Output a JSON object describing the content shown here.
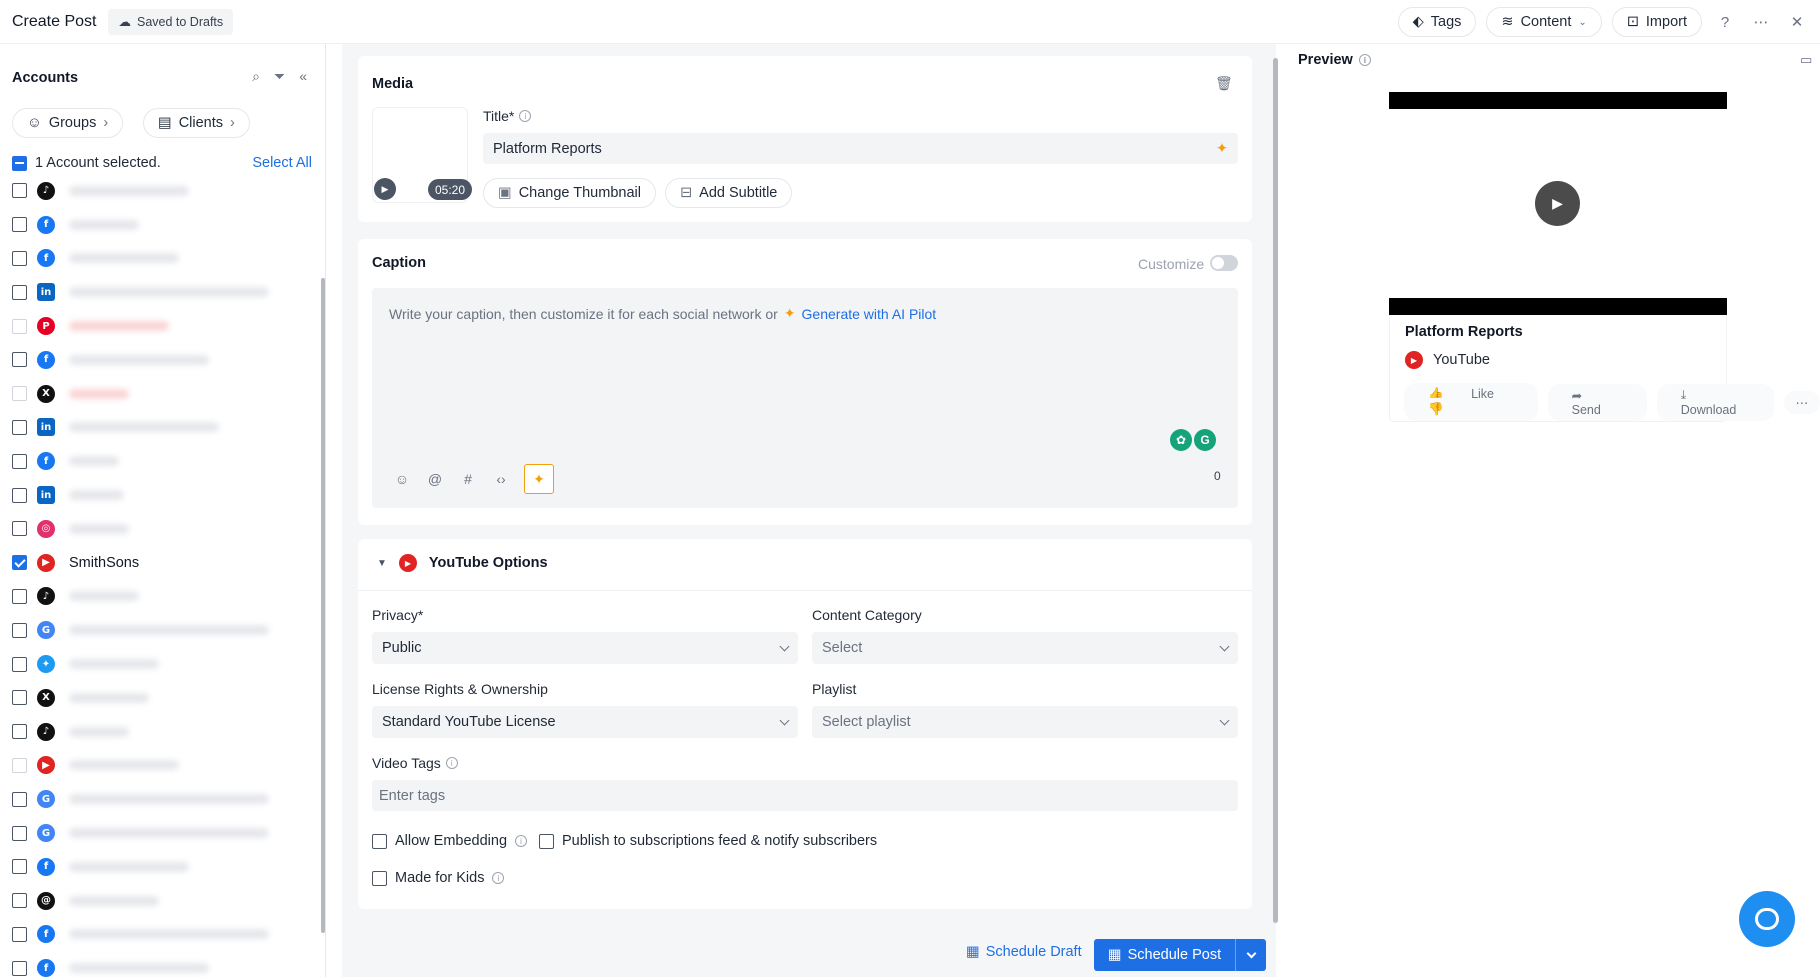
{
  "header": {
    "title": "Create Post",
    "saved_status": "Saved to Drafts",
    "tags_label": "Tags",
    "content_label": "Content",
    "import_label": "Import"
  },
  "sidebar": {
    "heading": "Accounts",
    "groups_label": "Groups",
    "clients_label": "Clients",
    "selected_text": "1 Account selected.",
    "select_all_label": "Select All",
    "selected_account_name": "SmithSons"
  },
  "media": {
    "heading": "Media",
    "title_label": "Title*",
    "title_value": "Platform Reports",
    "duration": "05:20",
    "change_thumbnail_label": "Change Thumbnail",
    "add_subtitle_label": "Add Subtitle"
  },
  "caption": {
    "heading": "Caption",
    "customize_label": "Customize",
    "placeholder": "Write your caption, then customize it for each social network or",
    "ai_link": "Generate with AI Pilot",
    "char_count": "0"
  },
  "youtube_options": {
    "heading": "YouTube Options",
    "privacy_label": "Privacy*",
    "privacy_value": "Public",
    "content_category_label": "Content Category",
    "content_category_value": "Select",
    "license_label": "License Rights & Ownership",
    "license_value": "Standard YouTube License",
    "playlist_label": "Playlist",
    "playlist_value": "Select playlist",
    "video_tags_label": "Video Tags",
    "video_tags_placeholder": "Enter tags",
    "allow_embedding_label": "Allow Embedding",
    "publish_feed_label": "Publish to subscriptions feed & notify subscribers",
    "made_for_kids_label": "Made for Kids"
  },
  "footer": {
    "schedule_draft_label": "Schedule Draft",
    "schedule_post_label": "Schedule Post"
  },
  "preview": {
    "heading": "Preview",
    "video_title": "Platform Reports",
    "channel": "YouTube",
    "like_label": "Like",
    "send_label": "Send",
    "download_label": "Download"
  },
  "colors": {
    "accent": "#1e6fe3",
    "youtube": "#e02424",
    "ai_spark": "#f59e0b"
  }
}
